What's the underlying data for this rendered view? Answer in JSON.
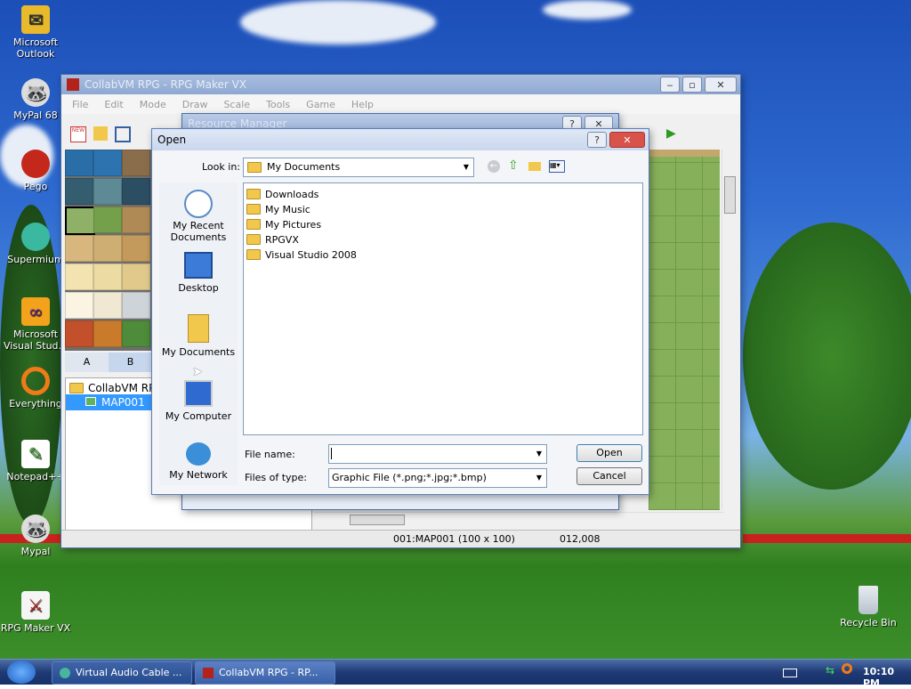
{
  "desktop": {
    "icons": [
      {
        "label": "Microsoft Outlook",
        "icon": "outlook-icon"
      },
      {
        "label": "MyPal 68",
        "icon": "mypal-icon"
      },
      {
        "label": "Pego",
        "icon": "pego-icon"
      },
      {
        "label": "Supermium",
        "icon": "supermium-icon"
      },
      {
        "label": "Microsoft Visual Stud...",
        "icon": "visual-studio-icon"
      },
      {
        "label": "Everything",
        "icon": "everything-icon"
      },
      {
        "label": "Notepad++",
        "icon": "notepadpp-icon"
      },
      {
        "label": "Mypal",
        "icon": "mypal-icon"
      },
      {
        "label": "RPG Maker VX",
        "icon": "rpgmaker-icon"
      },
      {
        "label": "Recycle Bin",
        "icon": "recycle-bin-icon"
      }
    ]
  },
  "rpg_window": {
    "title": "CollabVM RPG - RPG Maker VX",
    "menu": [
      "File",
      "Edit",
      "Mode",
      "Draw",
      "Scale",
      "Tools",
      "Game",
      "Help"
    ],
    "tileset_tabs": [
      "A",
      "B"
    ],
    "tree": {
      "root": "CollabVM RPG",
      "child": "MAP001"
    },
    "status": {
      "map": "001:MAP001 (100 x 100)",
      "coords": "012,008"
    }
  },
  "resource_window": {
    "title": "Resource Manager"
  },
  "open_dialog": {
    "title": "Open",
    "look_in_label": "Look in:",
    "look_in_value": "My Documents",
    "places": [
      "My Recent Documents",
      "Desktop",
      "My Documents",
      "My Computer",
      "My Network"
    ],
    "files": [
      "Downloads",
      "My Music",
      "My Pictures",
      "RPGVX",
      "Visual Studio 2008"
    ],
    "file_name_label": "File name:",
    "file_name_value": "",
    "files_of_type_label": "Files of type:",
    "files_of_type_value": "Graphic File (*.png;*.jpg;*.bmp)",
    "open_button": "Open",
    "cancel_button": "Cancel"
  },
  "taskbar": {
    "tasks": [
      "Virtual Audio Cable ...",
      "CollabVM RPG - RP..."
    ],
    "time": "10:10 PM"
  }
}
